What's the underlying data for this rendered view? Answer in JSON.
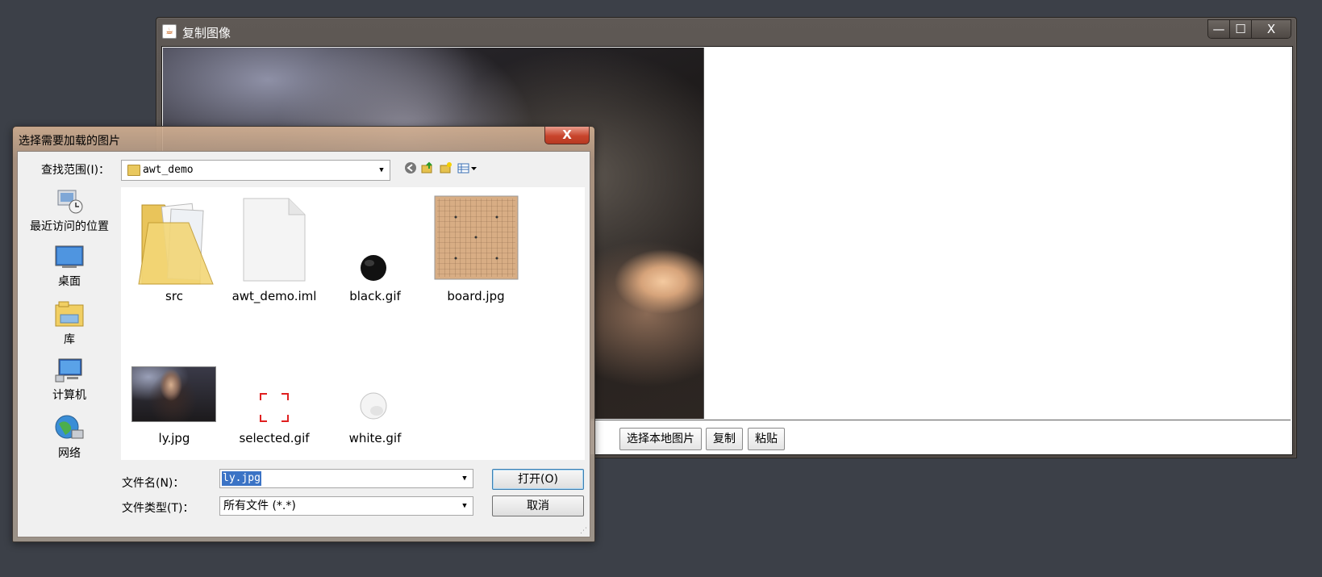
{
  "main_window": {
    "title": "复制图像",
    "icon": "java-cup-icon",
    "controls": {
      "minimize": "—",
      "maximize": "☐",
      "close": "X"
    },
    "buttons": {
      "select_local": "选择本地图片",
      "copy": "复制",
      "paste": "粘贴"
    }
  },
  "dialog": {
    "title": "选择需要加载的图片",
    "close_label": "X",
    "look_in_label": "查找范围(I)：",
    "look_in_value": "awt_demo",
    "sidebar": [
      {
        "label": "最近访问的位置",
        "icon": "recent-places-icon"
      },
      {
        "label": "桌面",
        "icon": "desktop-icon"
      },
      {
        "label": "库",
        "icon": "libraries-icon"
      },
      {
        "label": "计算机",
        "icon": "computer-icon"
      },
      {
        "label": "网络",
        "icon": "network-icon"
      }
    ],
    "files": [
      {
        "name": "src",
        "icon": "folder-icon"
      },
      {
        "name": "awt_demo.iml",
        "icon": "document-icon"
      },
      {
        "name": "black.gif",
        "icon": "black-stone-icon"
      },
      {
        "name": "board.jpg",
        "icon": "go-board-thumbnail"
      },
      {
        "name": "ly.jpg",
        "icon": "photo-thumbnail"
      },
      {
        "name": "selected.gif",
        "icon": "selection-corners-icon"
      },
      {
        "name": "white.gif",
        "icon": "white-stone-icon"
      }
    ],
    "file_name_label": "文件名(N)：",
    "file_name_value": "ly.jpg",
    "file_type_label": "文件类型(T)：",
    "file_type_value": "所有文件 (*.*)",
    "open_button": "打开(O)",
    "cancel_button": "取消"
  }
}
